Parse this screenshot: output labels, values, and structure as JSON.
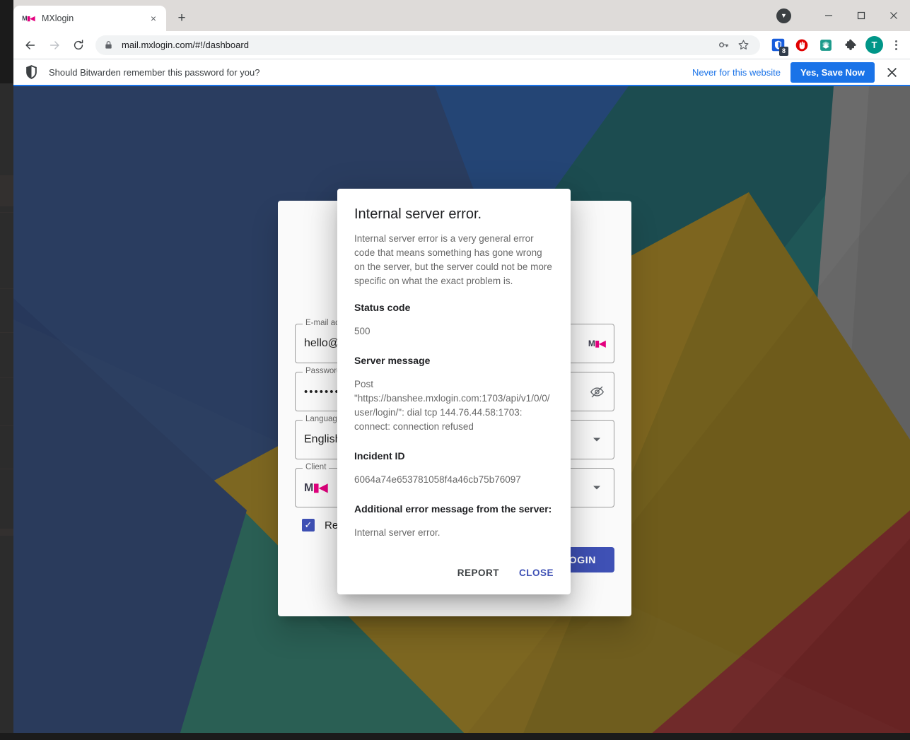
{
  "browser": {
    "tab": {
      "title": "MXlogin",
      "favicon": "mx-favicon",
      "close_label": "×"
    },
    "new_tab_label": "+",
    "window_controls": {
      "caret": "▼",
      "minimize": "–",
      "maximize": "□",
      "close": "✕"
    },
    "toolbar": {
      "back": "←",
      "forward": "→",
      "reload": "↻",
      "url": "mail.mxlogin.com/#!/dashboard",
      "lock_icon": "lock-icon",
      "key_icon": "key-icon",
      "star_icon": "star-icon",
      "extensions": [
        {
          "name": "bitwarden-extension-icon",
          "badge": "8",
          "color": "#175ddc"
        },
        {
          "name": "ublock-origin-extension-icon",
          "badge": "",
          "color": "#e00"
        },
        {
          "name": "evernote-extension-icon",
          "badge": "",
          "color": "#1b9a8b"
        },
        {
          "name": "extensions-puzzle-icon",
          "badge": "",
          "color": "#3c4043"
        }
      ],
      "avatar_initial": "T",
      "avatar_color": "#009688",
      "menu": "chrome-menu-icon"
    }
  },
  "infobar": {
    "icon": "bitwarden-shield-icon",
    "message": "Should Bitwarden remember this password for you?",
    "never_label": "Never for this website",
    "save_label": "Yes, Save Now",
    "close_label": "✕",
    "accent": "#1a73e8"
  },
  "login_form": {
    "fields": [
      {
        "label": "E-mail address",
        "value": "hello@",
        "suffix_icon": "mx-brand-icon",
        "name": "email-field"
      },
      {
        "label": "Password",
        "value": "•••••••••",
        "suffix_icon": "eye-off-icon",
        "name": "password-field"
      },
      {
        "label": "Language",
        "value": "English",
        "suffix_icon": "chevron-down-icon",
        "name": "language-select"
      },
      {
        "label": "Client",
        "value": "MX",
        "suffix_icon": "chevron-down-icon",
        "name": "client-select"
      }
    ],
    "remember": {
      "label": "Remember me",
      "checked": true,
      "check_glyph": "✓",
      "color": "#3f51b5"
    },
    "submit_label": "LOGIN",
    "submit_color": "#3f51b5"
  },
  "dialog": {
    "title": "Internal server error.",
    "description": "Internal server error is a very general error code that means something has gone wrong on the server, but the server could not be more specific on what the exact problem is.",
    "sections": [
      {
        "heading": "Status code",
        "value": "500"
      },
      {
        "heading": "Server message",
        "value": "Post \"https://banshee.mxlogin.com:1703/api/v1/0/0/user/login/\": dial tcp 144.76.44.58:1703: connect: connection refused"
      },
      {
        "heading": "Incident ID",
        "value": "6064a74e653781058f4a46cb75b76097"
      },
      {
        "heading": "Additional error message from the server:",
        "value": "Internal server error."
      }
    ],
    "report_label": "REPORT",
    "close_label": "CLOSE",
    "accent": "#3f51b5"
  },
  "background": {
    "colors": {
      "blue": "#3e5a8e",
      "blue_dark": "#3a5386",
      "blue_bright": "#3566ad",
      "teal": "#2f7f7f",
      "teal_dark": "#2a6f72",
      "green_teal": "#368374",
      "gold": "#b8962e",
      "gold_dark": "#a5882c",
      "gray": "#9e9e9e",
      "gray_dark": "#8d8d8d",
      "red": "#a93d3d",
      "red_dark": "#9e3636"
    }
  },
  "taskbar": {
    "clock": ""
  }
}
